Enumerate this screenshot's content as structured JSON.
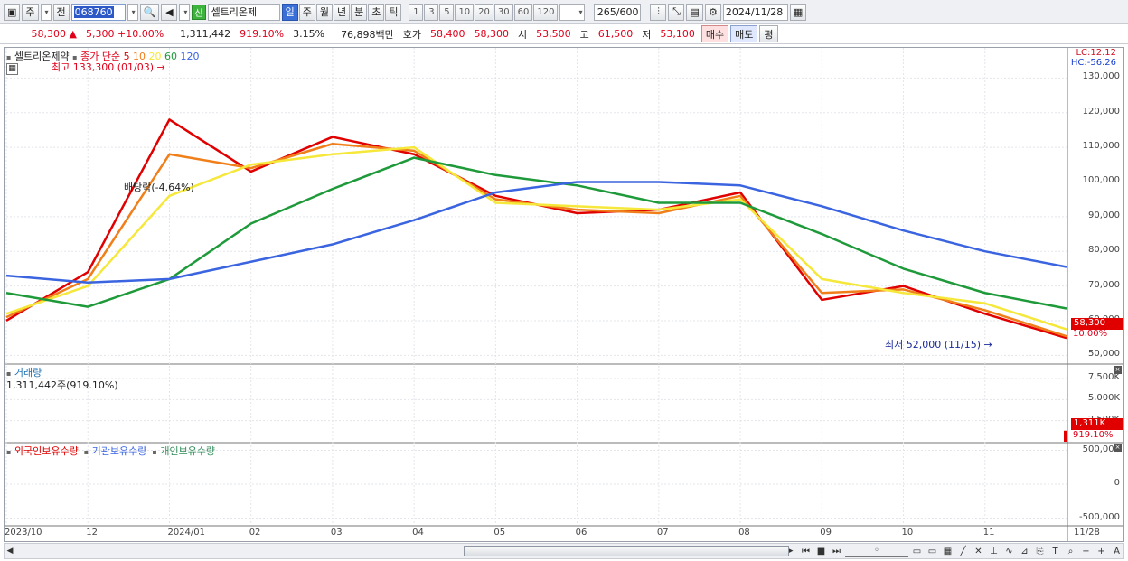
{
  "toolbar": {
    "mode1": "주",
    "mode2": "전",
    "code": "068760",
    "stock_name": "셀트리온제",
    "new_badge": "신",
    "periods": [
      "일",
      "주",
      "월",
      "년",
      "분",
      "초",
      "틱"
    ],
    "active_period": "일",
    "intervals": [
      "1",
      "3",
      "5",
      "10",
      "20",
      "30",
      "60",
      "120"
    ],
    "count": "265",
    "count_total": "/600",
    "date": "2024/11/28"
  },
  "quote": {
    "price": "58,300",
    "up_arrow": "▲",
    "change": "5,300",
    "change_pct": "+10.00%",
    "volume": "1,311,442",
    "volume_pct": "919.10%",
    "turnover": "3.15%",
    "trade_value": "76,898백만",
    "hoga_label": "호가",
    "ask": "58,400",
    "bid": "58,300",
    "open_label": "시",
    "open": "53,500",
    "high_label": "고",
    "high": "61,500",
    "low_label": "저",
    "low": "53,100",
    "buy_label": "매수",
    "sell_label": "매도",
    "eval_label": "평"
  },
  "price_pane": {
    "name": "셀트리온제약",
    "ma_title": "종가 단순",
    "ma_periods": [
      "5",
      "10",
      "20",
      "60",
      "120"
    ],
    "ma_colors": [
      "#e00000",
      "#f07f1a",
      "#f5e83a",
      "#1f9a3a",
      "#3a64e0"
    ],
    "lc": "LC:12.12",
    "hc": "HC:-56.26",
    "high_marker": "최고 133,300 (01/03)",
    "low_marker": "최저 52,000 (11/15)",
    "dividend_marker": "배당락(-4.64%)",
    "current_price_tag": "58,300",
    "current_pct_tag": "10.00%",
    "y_ticks": [
      "130,000",
      "120,000",
      "110,000",
      "100,000",
      "90,000",
      "80,000",
      "70,000",
      "60,000",
      "50,000"
    ]
  },
  "volume_pane": {
    "title": "거래량",
    "current": "1,311,442주(919.10%)",
    "y_ticks": [
      "7,500K",
      "5,000K",
      "2,500K"
    ],
    "current_tag": "1,311K",
    "current_pct_tag": "919.10%"
  },
  "holdings_pane": {
    "series_labels": [
      "외국인보유수량",
      "기관보유수량",
      "개인보유수량"
    ],
    "series_colors": [
      "#e00000",
      "#3a64e0",
      "#2e8b57"
    ],
    "y_ticks": [
      "500,000",
      "0",
      "-500,000"
    ]
  },
  "x_axis": [
    "2023/10",
    "12",
    "2024/01",
    "02",
    "03",
    "04",
    "05",
    "06",
    "07",
    "08",
    "09",
    "10",
    "11",
    "11/28"
  ],
  "chart_data": {
    "type": "line",
    "title": "셀트리온제약",
    "x": [
      "2023/10",
      "12",
      "2024/01",
      "02",
      "03",
      "04",
      "05",
      "06",
      "07",
      "08",
      "09",
      "10",
      "11",
      "11/28"
    ],
    "series": [
      {
        "name": "5",
        "values": [
          60000,
          74000,
          118000,
          103000,
          113000,
          108000,
          96000,
          91000,
          92000,
          97000,
          66000,
          70000,
          62000,
          55000
        ]
      },
      {
        "name": "10",
        "values": [
          61000,
          72000,
          108000,
          104000,
          111000,
          109000,
          95000,
          92000,
          91000,
          96000,
          68000,
          69000,
          63000,
          55500
        ]
      },
      {
        "name": "20",
        "values": [
          62000,
          70000,
          96000,
          105000,
          108000,
          110000,
          94000,
          93000,
          92000,
          95000,
          72000,
          68000,
          65000,
          57500
        ]
      },
      {
        "name": "60",
        "values": [
          68000,
          64000,
          72000,
          88000,
          98000,
          107000,
          102000,
          99000,
          94000,
          94000,
          85000,
          75000,
          68000,
          63500
        ]
      },
      {
        "name": "120",
        "values": [
          73000,
          71000,
          72000,
          77000,
          82000,
          89000,
          97000,
          100000,
          100000,
          99000,
          93000,
          86000,
          80000,
          75500
        ]
      }
    ],
    "ylim": [
      48000,
      134000
    ],
    "volume_ylim": [
      0,
      9000
    ],
    "volume_unit": "K",
    "volume_last": 1311
  }
}
